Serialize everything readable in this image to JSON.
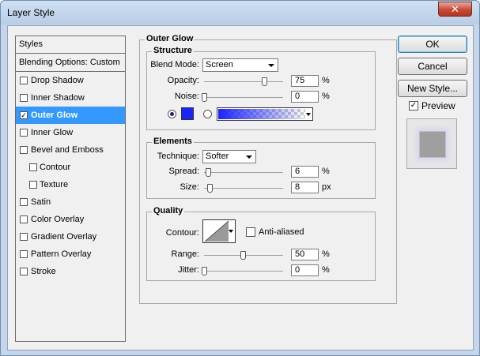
{
  "window": {
    "title": "Layer Style",
    "close_glyph": "✕"
  },
  "styles_list": {
    "header": "Styles",
    "blending": "Blending Options: Custom",
    "items": [
      {
        "label": "Drop Shadow",
        "checked": false,
        "mark": ""
      },
      {
        "label": "Inner Shadow",
        "checked": false,
        "mark": ""
      },
      {
        "label": "Outer Glow",
        "checked": true,
        "mark": "✓"
      },
      {
        "label": "Inner Glow",
        "checked": false,
        "mark": ""
      },
      {
        "label": "Bevel and Emboss",
        "checked": false,
        "mark": ""
      },
      {
        "label": "Contour",
        "checked": false,
        "mark": ""
      },
      {
        "label": "Texture",
        "checked": false,
        "mark": ""
      },
      {
        "label": "Satin",
        "checked": false,
        "mark": ""
      },
      {
        "label": "Color Overlay",
        "checked": false,
        "mark": ""
      },
      {
        "label": "Gradient Overlay",
        "checked": false,
        "mark": ""
      },
      {
        "label": "Pattern Overlay",
        "checked": false,
        "mark": ""
      },
      {
        "label": "Stroke",
        "checked": false,
        "mark": ""
      }
    ]
  },
  "outer_glow": {
    "title": "Outer Glow",
    "structure": {
      "title": "Structure",
      "blend_mode_label": "Blend Mode:",
      "blend_mode_value": "Screen",
      "opacity_label": "Opacity:",
      "opacity_value": "75",
      "opacity_unit": "%",
      "noise_label": "Noise:",
      "noise_value": "0",
      "noise_unit": "%",
      "glow_color": "#1a24ff",
      "gradient_color": "#1a24ff"
    },
    "elements": {
      "title": "Elements",
      "technique_label": "Technique:",
      "technique_value": "Softer",
      "spread_label": "Spread:",
      "spread_value": "6",
      "spread_unit": "%",
      "size_label": "Size:",
      "size_value": "8",
      "size_unit": "px"
    },
    "quality": {
      "title": "Quality",
      "contour_label": "Contour:",
      "anti_aliased_label": "Anti-aliased",
      "range_label": "Range:",
      "range_value": "50",
      "range_unit": "%",
      "jitter_label": "Jitter:",
      "jitter_value": "0",
      "jitter_unit": "%"
    }
  },
  "buttons": {
    "ok": "OK",
    "cancel": "Cancel",
    "new_style": "New Style...",
    "preview_label": "Preview",
    "preview_mark": "✓"
  }
}
